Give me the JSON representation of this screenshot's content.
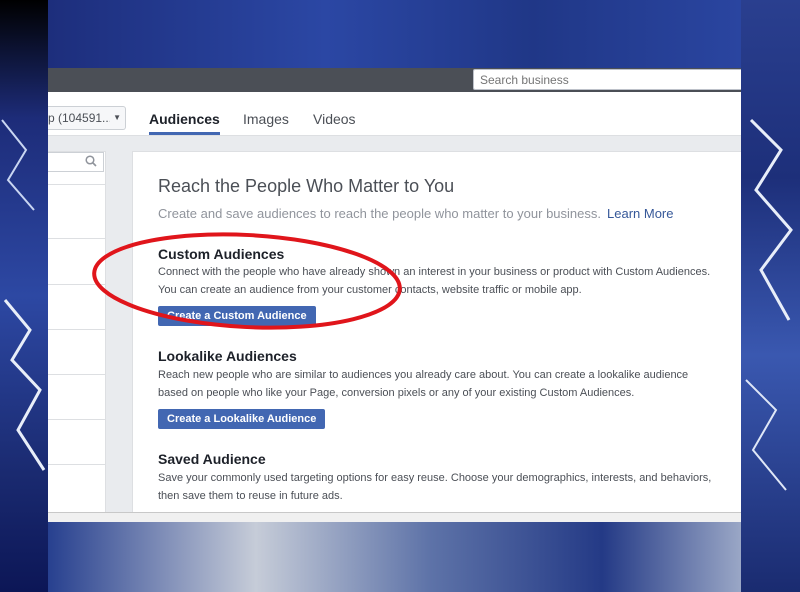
{
  "search": {
    "placeholder": "Search business"
  },
  "account": {
    "label": "p (104591..."
  },
  "tabs": [
    {
      "label": "Audiences",
      "active": true
    },
    {
      "label": "Images"
    },
    {
      "label": "Videos"
    }
  ],
  "main": {
    "heading": "Reach the People Who Matter to You",
    "lead": "Create and save audiences to reach the people who matter to your business.",
    "learn_more": "Learn More",
    "sections": [
      {
        "title": "Custom Audiences",
        "lines": [
          "Connect with the people who have already shown an interest in your business or product with Custom Audiences.",
          "You can create an audience from your customer contacts, website traffic or mobile app."
        ],
        "button": "Create a Custom Audience"
      },
      {
        "title": "Lookalike Audiences",
        "lines": [
          "Reach new people who are similar to audiences you already care about. You can create a lookalike audience",
          "based on people who like your Page, conversion pixels or any of your existing Custom Audiences."
        ],
        "button": "Create a Lookalike Audience"
      },
      {
        "title": "Saved Audience",
        "lines": [
          "Save your commonly used targeting options for easy reuse. Choose your demographics, interests, and behaviors,",
          "then save them to reuse in future ads."
        ]
      }
    ]
  },
  "colors": {
    "accent": "#4267b2",
    "link": "#365899",
    "annotation": "#e0151b"
  }
}
